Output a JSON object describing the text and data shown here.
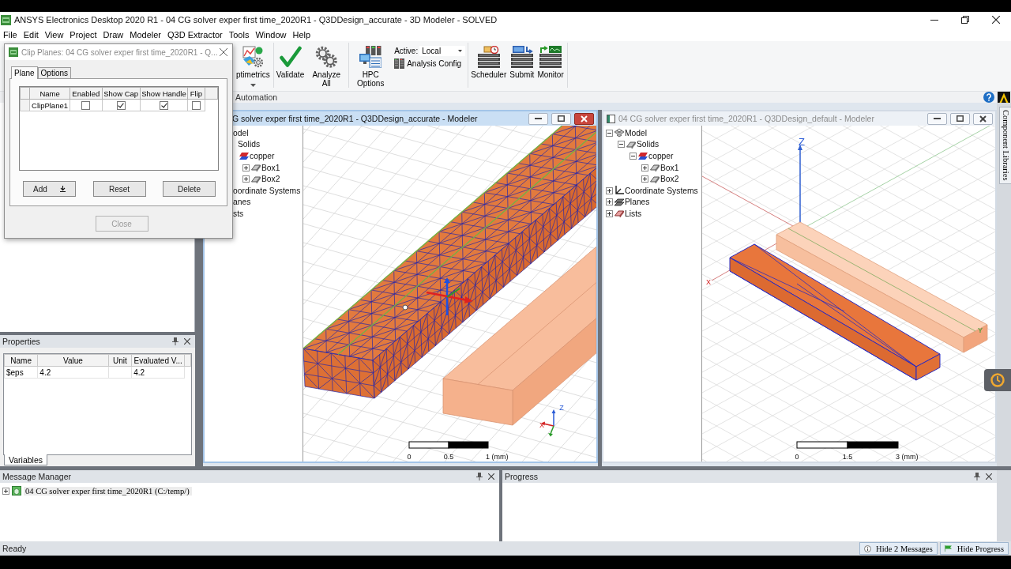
{
  "title_bar": {
    "title": "ANSYS Electronics Desktop 2020 R1 - 04 CG solver exper first time_2020R1 - Q3DDesign_accurate - 3D Modeler - SOLVED"
  },
  "menu": [
    "File",
    "Edit",
    "View",
    "Project",
    "Draw",
    "Modeler",
    "Q3D Extractor",
    "Tools",
    "Window",
    "Help"
  ],
  "ribbon": {
    "groups": [
      [
        {
          "kind": "optimetrics",
          "label": "ptimetrics",
          "menu": true
        }
      ],
      [
        {
          "kind": "validate",
          "label": "Validate",
          "menu": false
        },
        {
          "kind": "analyze",
          "label": "Analyze All",
          "menu": false
        }
      ],
      [
        {
          "kind": "hpc",
          "label": "HPC Options",
          "menu": false
        },
        {
          "kind": "settings",
          "label": "Active:",
          "value": "Local",
          "config": "Analysis Config"
        }
      ],
      [
        {
          "kind": "scheduler",
          "label": "Scheduler",
          "menu": false
        },
        {
          "kind": "submit",
          "label": "Submit",
          "menu": false
        },
        {
          "kind": "monitor",
          "label": "Monitor",
          "menu": false
        }
      ]
    ],
    "group_label": "Automation"
  },
  "clip_planes_dialog": {
    "title": "Clip Planes: 04 CG solver exper first time_2020R1 - Q...",
    "tabs": [
      {
        "label": "Plane",
        "selected": true
      },
      {
        "label": "Options",
        "selected": false
      }
    ],
    "columns": [
      "Name",
      "Enabled",
      "Show Cap",
      "Show Handle",
      "Flip"
    ],
    "rows": [
      {
        "name": "ClipPlane1",
        "enabled": false,
        "show_cap": true,
        "show_handle": true,
        "flip": false
      }
    ],
    "buttons": [
      {
        "kind": "menu",
        "label": "Add"
      },
      {
        "kind": "plain",
        "label": "Reset"
      },
      {
        "kind": "plain",
        "label": "Delete"
      }
    ],
    "close_button": {
      "label": "Close",
      "disabled": true
    }
  },
  "properties_panel": {
    "title": "Properties",
    "columns": [
      "Name",
      "Value",
      "Unit",
      "Evaluated V..."
    ],
    "rows": [
      {
        "name": "$eps",
        "value": "4.2",
        "evaluated": "4.2"
      }
    ],
    "tab": "Variables"
  },
  "modeler_windows": [
    {
      "kind": "closeup",
      "title": "G solver exper first time_2020R1 - Q3DDesign_accurate - Modeler",
      "active": true,
      "tree": [
        {
          "label": "odel",
          "children": [
            {
              "label": "Solids",
              "children": [
                {
                  "label": "copper",
                  "kind": "material",
                  "children": [
                    {
                      "label": "Box1",
                      "kind": "box",
                      "expanded": false
                    },
                    {
                      "label": "Box2",
                      "kind": "box",
                      "expanded": false
                    }
                  ]
                }
              ]
            }
          ]
        },
        {
          "label": "oordinate Systems"
        },
        {
          "label": "anes"
        },
        {
          "label": "sts"
        }
      ],
      "axis_labels": [
        {
          "kind": "z",
          "label": "Z"
        },
        {
          "kind": "x",
          "label": "X"
        }
      ],
      "scale_labels": [
        "0",
        "0.5",
        "1 (mm)"
      ]
    },
    {
      "kind": "overview",
      "title": "04 CG solver exper first time_2020R1 - Q3DDesign_default - Modeler",
      "active": false,
      "tree": [
        {
          "label": "Model",
          "kind": "model",
          "expanded": true,
          "children": [
            {
              "label": "Solids",
              "kind": "solids",
              "expanded": true,
              "children": [
                {
                  "label": "copper",
                  "kind": "material",
                  "expanded": true,
                  "children": [
                    {
                      "label": "Box1",
                      "kind": "box",
                      "expanded": false
                    },
                    {
                      "label": "Box2",
                      "kind": "box",
                      "expanded": false
                    }
                  ]
                }
              ]
            }
          ]
        },
        {
          "label": "Coordinate Systems",
          "kind": "coordinates",
          "expanded": false
        },
        {
          "label": "Planes",
          "kind": "planes",
          "expanded": false
        },
        {
          "label": "Lists",
          "kind": "lists",
          "expanded": false
        }
      ],
      "axis_labels": [
        {
          "kind": "z",
          "label": "Z"
        },
        {
          "kind": "x",
          "label": "X"
        },
        {
          "kind": "y",
          "label": "Y"
        }
      ],
      "scale_labels": [
        "0",
        "1.5",
        "3 (mm)"
      ]
    }
  ],
  "side_dock": {
    "tab": "Component Libraries"
  },
  "message_manager": {
    "title": "Message Manager",
    "items": [
      {
        "label": "04 CG solver exper first time_2020R1 (C:/temp/)",
        "expanded": false,
        "selected": true
      }
    ]
  },
  "progress": {
    "title": "Progress"
  },
  "status_bar": {
    "text": "Ready",
    "buttons": [
      {
        "kind": "info",
        "label": "Hide 2 Messages"
      },
      {
        "kind": "flag",
        "label": "Hide Progress"
      }
    ]
  }
}
